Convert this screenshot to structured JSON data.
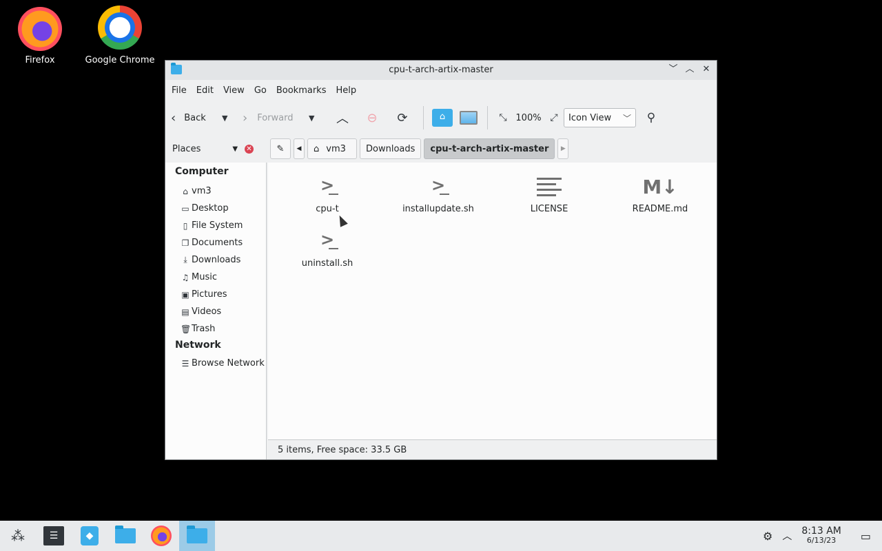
{
  "desktop": {
    "icons": [
      {
        "label": "Firefox"
      },
      {
        "label": "Google Chrome"
      }
    ]
  },
  "window": {
    "title": "cpu-t-arch-artix-master",
    "menu": [
      "File",
      "Edit",
      "View",
      "Go",
      "Bookmarks",
      "Help"
    ],
    "toolbar": {
      "back_label": "Back",
      "forward_label": "Forward",
      "zoom_label": "100%",
      "view_mode": "Icon View"
    },
    "places_label": "Places",
    "breadcrumbs": [
      "vm3",
      "Downloads",
      "cpu-t-arch-artix-master"
    ],
    "sidebar": {
      "computer_heading": "Computer",
      "computer_items": [
        {
          "label": "vm3",
          "icon": "home-icon"
        },
        {
          "label": "Desktop",
          "icon": "desktop-icon"
        },
        {
          "label": "File System",
          "icon": "drive-icon"
        },
        {
          "label": "Documents",
          "icon": "documents-icon"
        },
        {
          "label": "Downloads",
          "icon": "download-icon"
        },
        {
          "label": "Music",
          "icon": "music-icon"
        },
        {
          "label": "Pictures",
          "icon": "pictures-icon"
        },
        {
          "label": "Videos",
          "icon": "videos-icon"
        },
        {
          "label": "Trash",
          "icon": "trash-icon"
        }
      ],
      "network_heading": "Network",
      "network_items": [
        {
          "label": "Browse Network",
          "icon": "network-icon"
        }
      ]
    },
    "files": [
      {
        "name": "cpu-t",
        "icon": "terminal-script-icon"
      },
      {
        "name": "installupdate.sh",
        "icon": "terminal-script-icon"
      },
      {
        "name": "LICENSE",
        "icon": "text-file-icon"
      },
      {
        "name": "README.md",
        "icon": "markdown-icon"
      },
      {
        "name": "uninstall.sh",
        "icon": "terminal-script-icon"
      }
    ],
    "status": "5 items, Free space: 33.5 GB"
  },
  "taskbar": {
    "time": "8:13 AM",
    "date": "6/13/23"
  },
  "colors": {
    "accent": "#3daee9",
    "close_red": "#da4453",
    "desktop_bg": "#000000"
  }
}
